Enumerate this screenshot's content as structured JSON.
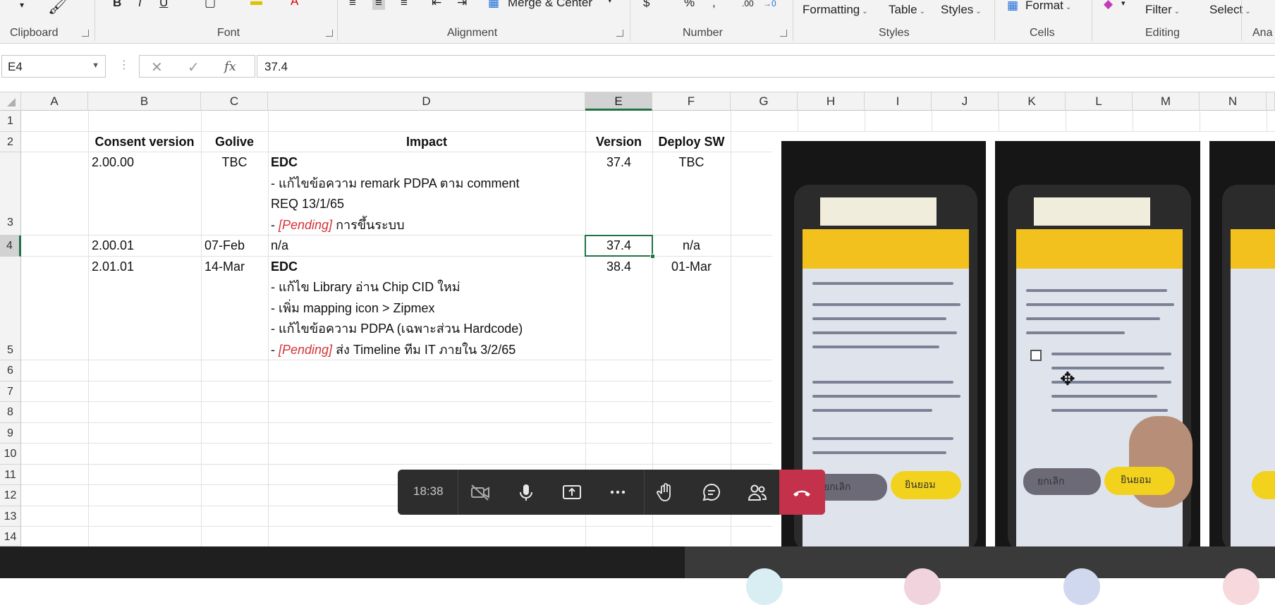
{
  "ribbon": {
    "top_labels": [
      "Merge & Center",
      "Formatting",
      "Table",
      "Styles",
      "Format",
      "Filter",
      "Select"
    ],
    "number_symbols": [
      "$",
      "%",
      ",",
      ".00",
      "→0"
    ],
    "groups": [
      "Clipboard",
      "Font",
      "Alignment",
      "Number",
      "Styles",
      "Cells",
      "Editing",
      "Ana"
    ]
  },
  "formula_bar": {
    "name_box": "E4",
    "fx_label": "fx",
    "value": "37.4"
  },
  "columns": [
    "A",
    "B",
    "C",
    "D",
    "E",
    "F",
    "G",
    "H",
    "I",
    "J",
    "K",
    "L",
    "M",
    "N"
  ],
  "rows": [
    "1",
    "2",
    "3",
    "4",
    "5",
    "6",
    "7",
    "8",
    "9",
    "10",
    "11",
    "12",
    "13",
    "14"
  ],
  "headers": {
    "b": "Consent version",
    "c": "Golive",
    "d": "Impact",
    "e": "Version",
    "f": "Deploy SW"
  },
  "row3": {
    "b": "2.00.00",
    "c": "TBC",
    "d_title": "EDC",
    "d_line1": "- แก้ไขข้อความ remark PDPA ตาม comment",
    "d_line2": "REQ 13/1/65",
    "d_line3_prefix": "- ",
    "d_line3_pending": "[Pending]",
    "d_line3_rest": " การขึ้นระบบ",
    "e": "37.4",
    "f": "TBC"
  },
  "row4": {
    "b": "2.00.01",
    "c": "07-Feb",
    "d": "n/a",
    "e": "37.4",
    "f": "n/a"
  },
  "row5": {
    "b": "2.01.01",
    "c": "14-Mar",
    "d_title": "EDC",
    "d_line1": "- แก้ไข Library อ่าน Chip CID ใหม่",
    "d_line2": "- เพิ่ม mapping icon > Zipmex",
    "d_line3": "- แก้ไขข้อความ PDPA (เฉพาะส่วน Hardcode)",
    "d_line4_prefix": "- ",
    "d_line4_pending": "[Pending]",
    "d_line4_rest": " ส่ง Timeline ทีม IT ภายใน 3/2/65",
    "e": "38.4",
    "f": "01-Mar"
  },
  "phone_buttons": {
    "cancel": "ยกเลิก",
    "accept": "ยินยอม"
  },
  "meeting": {
    "timer": "18:38"
  },
  "colors": {
    "excel_green": "#217346",
    "pending_red": "#d13438",
    "hangup_red": "#c4314b",
    "phone_yellow": "#f2c11d"
  }
}
